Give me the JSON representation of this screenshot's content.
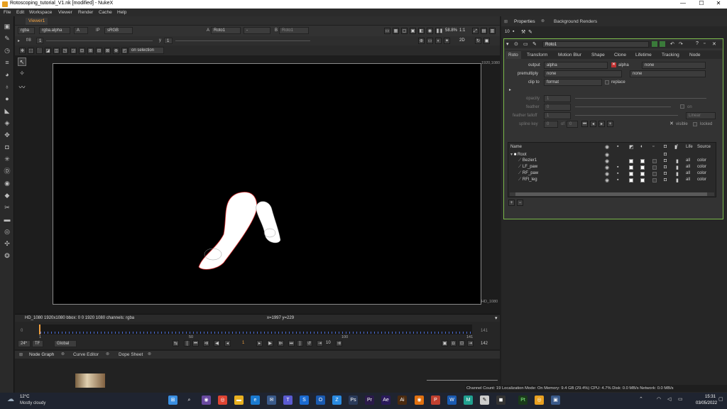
{
  "window": {
    "title": "Rotoscoping_tutorial_V1.nk [modified] - NukeX",
    "controls": [
      "—",
      "☐",
      "✕"
    ]
  },
  "menu": [
    "File",
    "Edit",
    "Workspace",
    "Viewer",
    "Render",
    "Cache",
    "Help"
  ],
  "viewer": {
    "tab": "Viewer1",
    "channels": "rgba",
    "layer": "rgba.alpha",
    "input_a": "A",
    "ip": "IP",
    "colorspace": "sRGB",
    "a_node": "A",
    "a_value": "Roto1",
    "dash": "-",
    "b_node": "B",
    "b_value": "Roto1",
    "zoom": "58.8%",
    "ratio": "1:1",
    "fstop": "f/8",
    "frame_field": "1",
    "y_label": "y",
    "y_value": "1",
    "view_mode": "2D",
    "on_selection": "on selection",
    "format_tr": "1920,1080",
    "format_br": "HD_1080",
    "info_left": "HD_1080 1920x1080  bbox: 0 0 1920 1080 channels: rgba",
    "info_coords": "x=1997 y=229"
  },
  "timeline": {
    "start": "1",
    "end": "141",
    "end_right": "141",
    "tick0": "0",
    "tick50": "50",
    "tick100": "100",
    "tick141": "141",
    "fps": "24*",
    "tf": "TF",
    "global": "Global",
    "current_frame": "1",
    "step": "10",
    "frame_count": "142"
  },
  "node_tabs": [
    "Node Graph",
    "Curve Editor",
    "Dope Sheet"
  ],
  "right_tabs": [
    "Properties",
    "Background Renders"
  ],
  "properties": {
    "max_panels": "10",
    "node_name": "Roto1",
    "tabs": [
      "Roto",
      "Transform",
      "Motion Blur",
      "Shape",
      "Clone",
      "Lifetime",
      "Tracking",
      "Node"
    ],
    "output_label": "output",
    "output_value": "alpha",
    "alpha_label": "alpha",
    "none1": "none",
    "premult_label": "premultiply",
    "premult_value": "none",
    "none2": "none",
    "clip_label": "clip to",
    "clip_value": "format",
    "replace_label": "replace",
    "opacity_label": "opacity",
    "opacity_value": "1",
    "feather_label": "feather",
    "feather_value": "0",
    "on_label": "on",
    "falloff_label": "feather falloff",
    "falloff_value": "1",
    "falloff_mode": "Linear",
    "splinekey_label": "spline key",
    "splinekey_value": "0",
    "of_label": "of",
    "of_value": "0",
    "visible_label": "visible",
    "locked_label": "locked",
    "tree_headers": {
      "name": "Name",
      "life": "Life",
      "source": "Source"
    },
    "tree": [
      {
        "name": "Root",
        "life": "",
        "source": ""
      },
      {
        "name": "Bezier1",
        "life": "all",
        "source": "color"
      },
      {
        "name": "LF_paw",
        "life": "all",
        "source": "color"
      },
      {
        "name": "RF_paw",
        "life": "all",
        "source": "color"
      },
      {
        "name": "RFl_leg",
        "life": "all",
        "source": "color"
      }
    ]
  },
  "status": "Channel Count: 19  Localization Mode: On  Memory: 9.4 GB (29.4%)  CPU: 4.7%  Disk: 0.0 MB/s  Network: 0.0 MB/s",
  "taskbar": {
    "temp": "12°C",
    "weather": "Mostly cloudy",
    "time": "15:31",
    "date": "03/05/2022"
  },
  "colors": {
    "accent": "#f0a040",
    "panel_border": "#7ab84a",
    "roto_stroke": "#d83030"
  }
}
